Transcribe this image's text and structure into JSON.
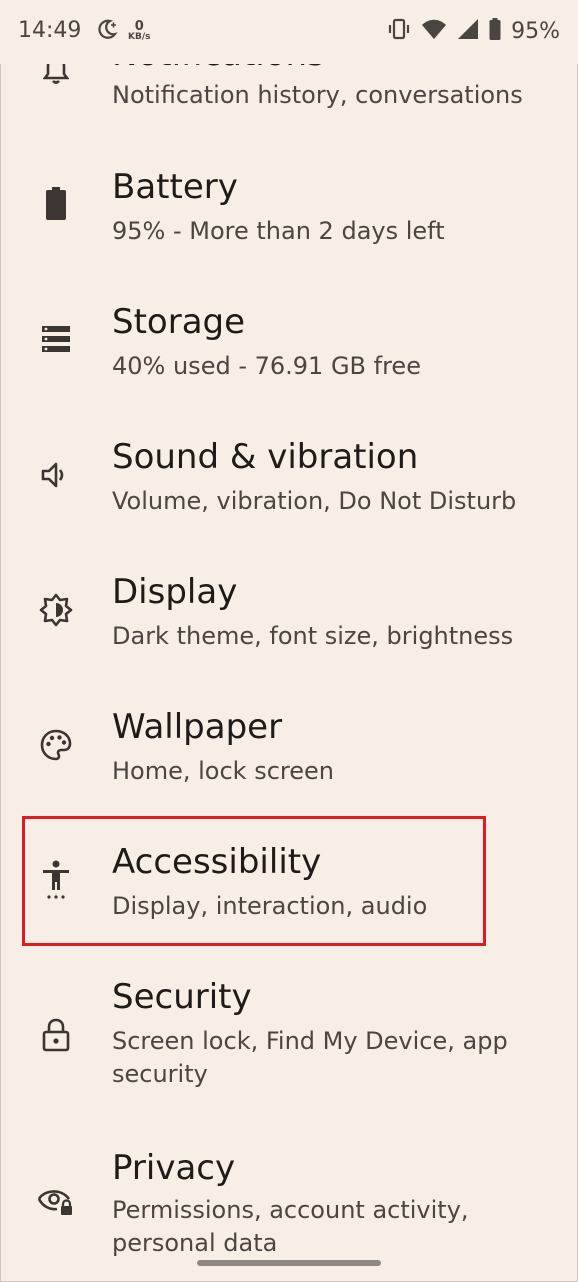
{
  "status_bar": {
    "time": "14:49",
    "data_rate_value": "0",
    "data_rate_unit": "KB/s",
    "battery_percent": "95%",
    "icons": [
      "do-not-disturb-moon-icon",
      "vibrate-icon",
      "wifi-icon",
      "cell-signal-icon",
      "battery-icon"
    ]
  },
  "settings": {
    "items": [
      {
        "id": "notifications",
        "icon": "bell-icon",
        "title": "Notifications",
        "subtitle": "Notification history, conversations"
      },
      {
        "id": "battery",
        "icon": "battery-icon",
        "title": "Battery",
        "subtitle": "95% - More than 2 days left"
      },
      {
        "id": "storage",
        "icon": "storage-icon",
        "title": "Storage",
        "subtitle": "40% used - 76.91 GB free"
      },
      {
        "id": "sound",
        "icon": "speaker-icon",
        "title": "Sound & vibration",
        "subtitle": "Volume, vibration, Do Not Disturb"
      },
      {
        "id": "display",
        "icon": "brightness-icon",
        "title": "Display",
        "subtitle": "Dark theme, font size, brightness"
      },
      {
        "id": "wallpaper",
        "icon": "palette-icon",
        "title": "Wallpaper",
        "subtitle": "Home, lock screen"
      },
      {
        "id": "accessibility",
        "icon": "accessibility-icon",
        "title": "Accessibility",
        "subtitle": "Display, interaction, audio"
      },
      {
        "id": "security",
        "icon": "lock-icon",
        "title": "Security",
        "subtitle": "Screen lock, Find My Device, app security"
      },
      {
        "id": "privacy",
        "icon": "privacy-eye-icon",
        "title": "Privacy",
        "subtitle": "Permissions, account activity, personal data"
      }
    ]
  },
  "colors": {
    "background": "#f7eee5",
    "highlight": "#e01b24",
    "text_primary": "#1e1b18",
    "text_secondary": "#4b4641"
  }
}
